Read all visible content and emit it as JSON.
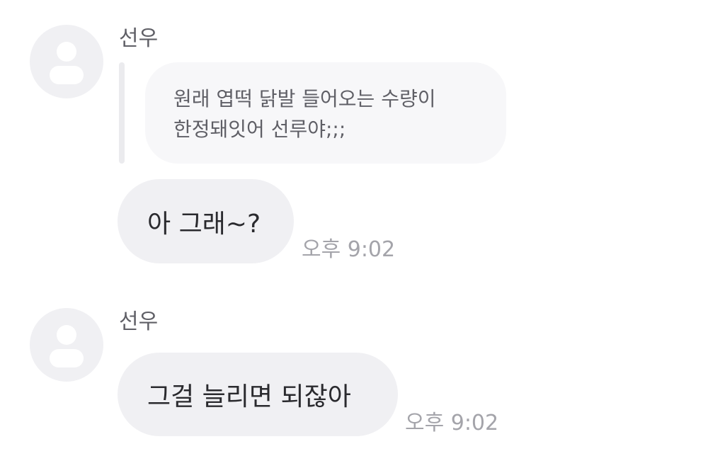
{
  "messages": [
    {
      "sender": "선우",
      "avatar_icon": "default-profile-icon",
      "quote": {
        "lines": [
          "원래 엽떡 닭발 들어오는 수량이",
          "한정돼잇어 선루야;;;"
        ]
      },
      "text": "아 그래~?",
      "time": "오후 9:02"
    },
    {
      "sender": "선우",
      "avatar_icon": "default-profile-icon",
      "text": "그걸 늘리면 되잖아",
      "time": "오후 9:02"
    }
  ],
  "colors": {
    "avatar_bg": "#f0f0f3",
    "avatar_icon": "#ffffff",
    "bubble_bg": "#f0f0f3",
    "quote_bg": "#f7f7f9",
    "quote_bar": "#ebebee",
    "name_text": "#5f5f66",
    "message_text": "#2a2a2e",
    "time_text": "#a4a4aa"
  }
}
